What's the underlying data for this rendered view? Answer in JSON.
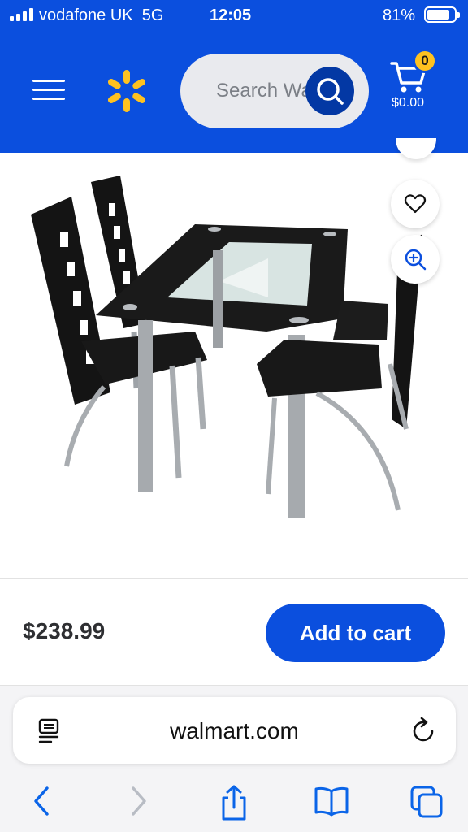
{
  "status_bar": {
    "carrier": "vodafone UK",
    "network": "5G",
    "time": "12:05",
    "battery": "81%"
  },
  "header": {
    "search_placeholder": "Search Walmart",
    "cart_count": "0",
    "cart_total": "$0.00"
  },
  "product": {
    "price": "$238.99",
    "add_to_cart_label": "Add to cart"
  },
  "browser": {
    "url": "walmart.com"
  },
  "colors": {
    "brand_blue": "#0b4fde",
    "brand_yellow": "#ffc220",
    "search_button": "#0338a4"
  },
  "icons": {
    "menu": "hamburger-menu-icon",
    "logo": "walmart-spark-icon",
    "search": "search-icon",
    "cart": "shopping-cart-icon",
    "favorite": "heart-icon",
    "zoom": "zoom-in-icon",
    "reader": "reader-mode-icon",
    "reload": "reload-icon",
    "back": "chevron-left-icon",
    "forward": "chevron-right-icon",
    "share": "share-icon",
    "bookmarks": "bookmarks-icon",
    "tabs": "tabs-icon"
  }
}
